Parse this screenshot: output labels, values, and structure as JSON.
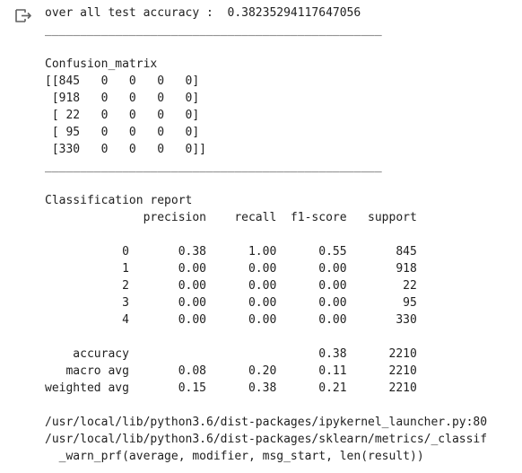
{
  "output": {
    "icon": "output-redirect-icon",
    "accuracy_line": "over all test accuracy :  0.38235294117647056",
    "separator_1": "________________________________________________",
    "blank_1": "",
    "cm_title": "Confusion_matrix",
    "cm_rows": [
      "[[845   0   0   0   0]",
      " [918   0   0   0   0]",
      " [ 22   0   0   0   0]",
      " [ 95   0   0   0   0]",
      " [330   0   0   0   0]]"
    ],
    "separator_2": "________________________________________________",
    "blank_2": "",
    "report_title": "Classification report",
    "report_header": "              precision    recall  f1-score   support",
    "blank_3": "",
    "report_rows": [
      "           0       0.38      1.00      0.55       845",
      "           1       0.00      0.00      0.00       918",
      "           2       0.00      0.00      0.00        22",
      "           3       0.00      0.00      0.00        95",
      "           4       0.00      0.00      0.00       330"
    ],
    "blank_4": "",
    "accuracy_row": "    accuracy                           0.38      2210",
    "macro_row": "   macro avg       0.08      0.20      0.11      2210",
    "weighted_row": "weighted avg       0.15      0.38      0.21      2210",
    "blank_5": "",
    "warning_lines": [
      "/usr/local/lib/python3.6/dist-packages/ipykernel_launcher.py:80",
      "/usr/local/lib/python3.6/dist-packages/sklearn/metrics/_classif",
      "  _warn_prf(average, modifier, msg_start, len(result))"
    ]
  }
}
